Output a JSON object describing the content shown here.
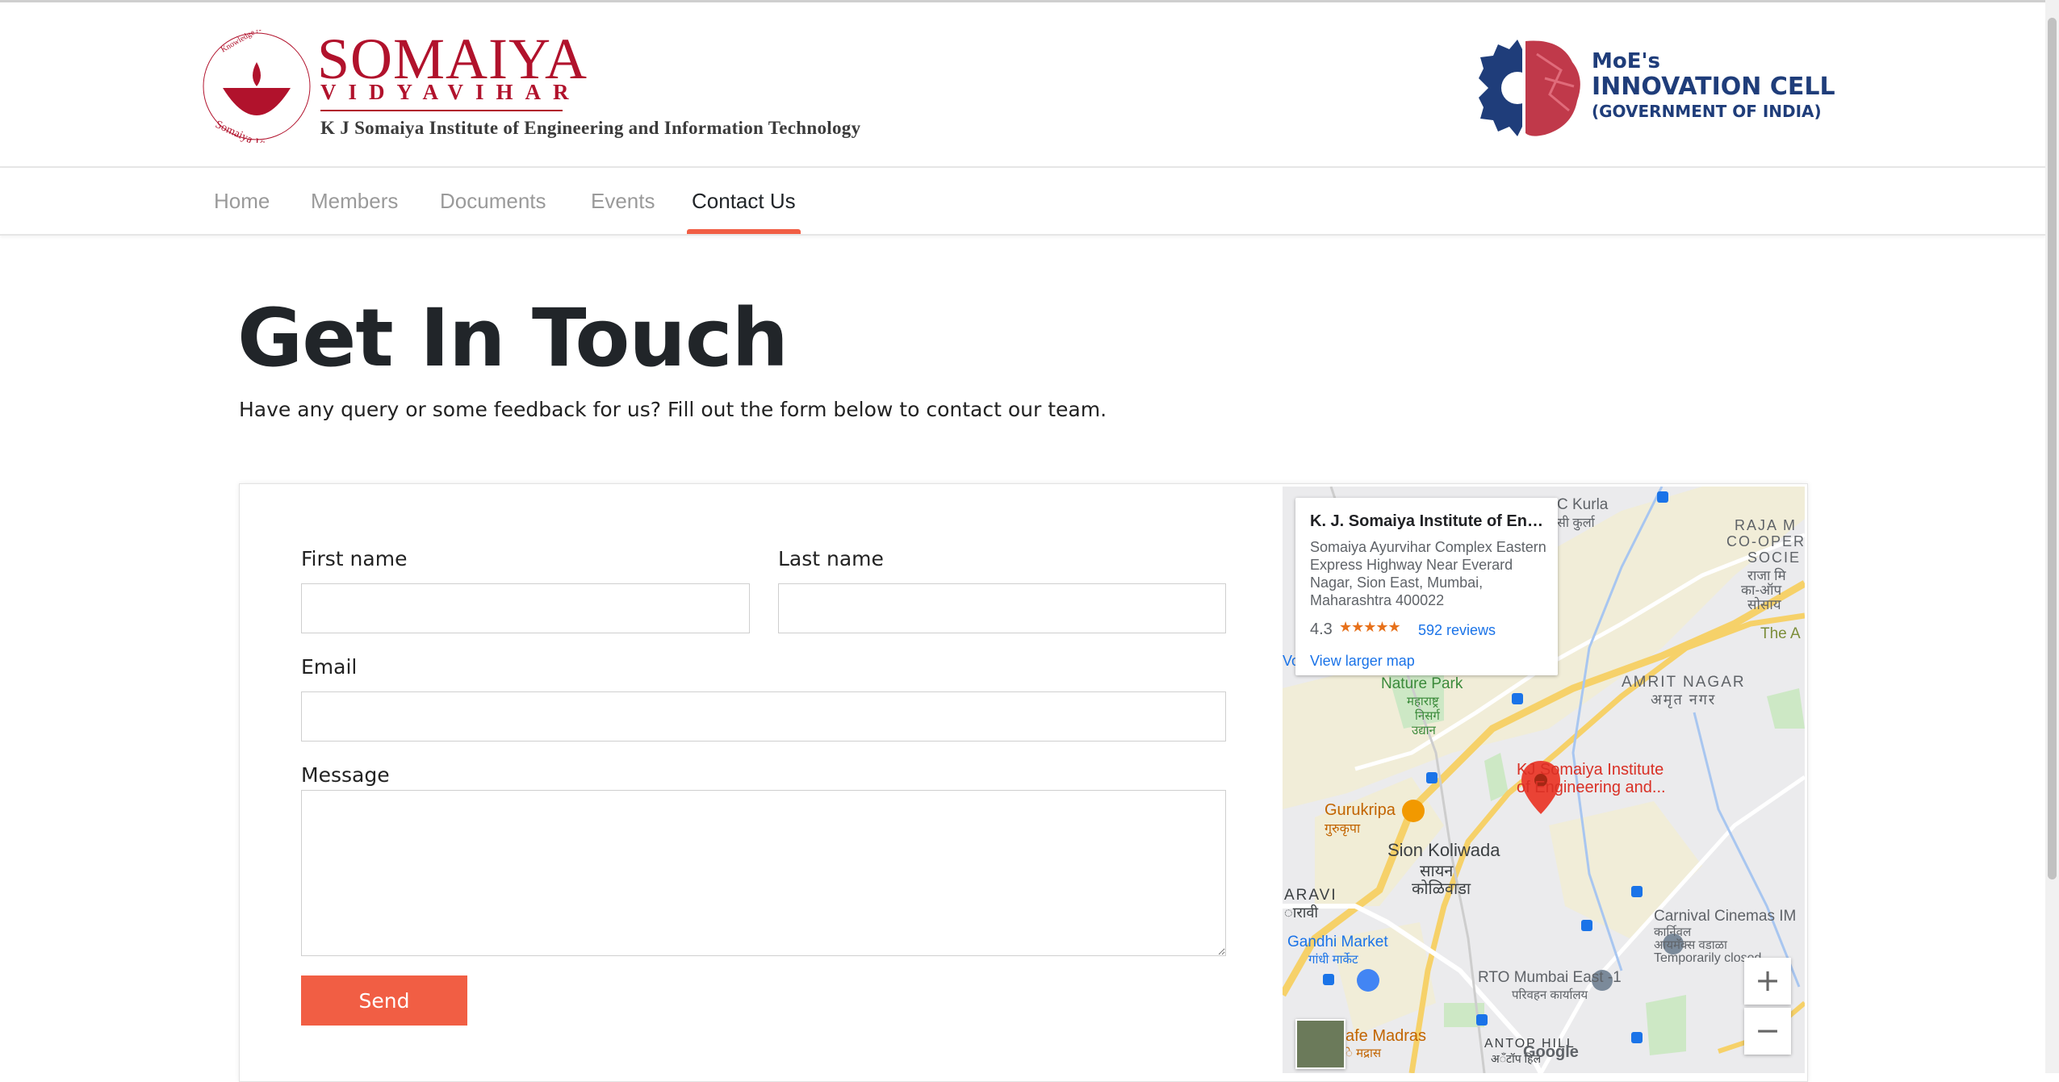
{
  "brand": {
    "name": "SOMAIYA",
    "sub": "VIDYAVIHAR",
    "institute": "K J Somaiya Institute of Engineering and Information Technology",
    "seal_text_top": "Knowledge Alone Liberates",
    "seal_text_bottom": "Somaiya Vidyavihar",
    "color": "#b1122c"
  },
  "moe": {
    "line1": "MoE's",
    "line2": "INNOVATION CELL",
    "line3": "(GOVERNMENT OF INDIA)",
    "color": "#1f3d7a"
  },
  "nav": {
    "items": [
      {
        "label": "Home",
        "active": false
      },
      {
        "label": "Members",
        "active": false
      },
      {
        "label": "Documents",
        "active": false
      },
      {
        "label": "Events",
        "active": false
      },
      {
        "label": "Contact Us",
        "active": true
      }
    ],
    "accent": "#f15e44"
  },
  "page": {
    "title": "Get In Touch",
    "lead": "Have any query or some feedback for us? Fill out the form below to contact our team."
  },
  "form": {
    "first_name_label": "First name",
    "first_name_value": "",
    "last_name_label": "Last name",
    "last_name_value": "",
    "email_label": "Email",
    "email_value": "",
    "message_label": "Message",
    "message_value": "",
    "send_label": "Send"
  },
  "map": {
    "info_title": "K. J. Somaiya Institute of Engi...",
    "info_address": "Somaiya Ayurvihar Complex Eastern Express Highway Near Everard Nagar, Sion East, Mumbai, Maharashtra 400022",
    "rating": "4.3",
    "stars": "★★★★★",
    "reviews": "592 reviews",
    "view_larger": "View larger map",
    "pin_label_1": "KJ Somaiya Institute",
    "pin_label_2": "of Engineering and...",
    "places": {
      "kurla": "C Kurla",
      "kurla_mr": "सी कुर्ला",
      "raja": "RAJA M",
      "coop": "CO-OPER",
      "soci": "SOCIE",
      "raja_mr": "राजा मि",
      "ka_op": "का-ऑप",
      "sosa": "सोसाय",
      "the_a": "The A",
      "amrit": "AMRIT NAGAR",
      "amrit_mr": "अमृत नगर",
      "nature": "Nature Park",
      "nature_mr1": "महाराष्ट्र",
      "nature_mr2": "निसर्ग",
      "nature_mr3": "उद्यान",
      "gurukripa": "Gurukripa",
      "gurukripa_mr": "गुरुकृपा",
      "sion": "Sion Koliwada",
      "sion_mr1": "सायन",
      "sion_mr2": "कोळिवाडा",
      "aravi": "ARAVI",
      "aravi_mr": "ारावी",
      "gandhi": "Gandhi Market",
      "gandhi_mr": "गांधी मार्केट",
      "carnival": "Carnival Cinemas IM",
      "carnival_mr1": "कार्निवल",
      "carnival_mr2": "आयमॅक्स वडाळा",
      "carnival_closed": "Temporarily closed",
      "rto": "RTO Mumbai East -1",
      "rto_mr": "परिवहन कार्यालय",
      "cafe": "afe Madras",
      "cafe_mr": "े मद्रास",
      "antop": "ANTOP HILL",
      "antop_mr": "अॅंटॉप हिल",
      "google": "Google",
      "vo": "Vo"
    },
    "zoom_in": "+",
    "zoom_out": "−"
  }
}
